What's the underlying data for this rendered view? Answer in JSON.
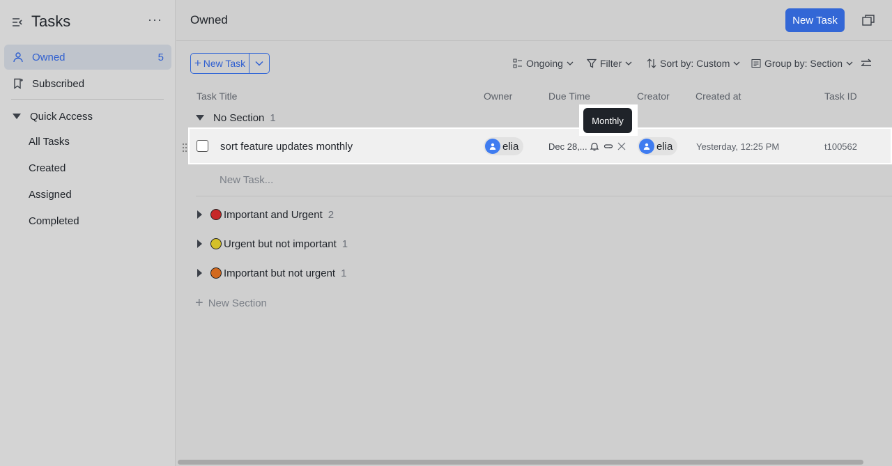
{
  "sidebar": {
    "title": "Tasks",
    "more": "···",
    "nav": [
      {
        "label": "Owned",
        "count": "5"
      },
      {
        "label": "Subscribed"
      }
    ],
    "quick_access": {
      "label": "Quick Access",
      "items": [
        "All Tasks",
        "Created",
        "Assigned",
        "Completed"
      ]
    }
  },
  "header": {
    "title": "Owned",
    "new_task_button": "New Task"
  },
  "toolbar": {
    "new_task_split": "New Task",
    "ongoing": "Ongoing",
    "filter": "Filter",
    "sort": "Sort by: Custom",
    "group": "Group by: Section"
  },
  "columns": [
    "Task Title",
    "Owner",
    "Due Time",
    "Creator",
    "Created at",
    "Task ID"
  ],
  "sections": [
    {
      "name": "No Section",
      "count": "1",
      "expanded": true
    },
    {
      "name": "Important and Urgent",
      "count": "2",
      "color": "#c62828"
    },
    {
      "name": "Urgent but not important",
      "count": "1",
      "color": "#d4c02a"
    },
    {
      "name": "Important but not urgent",
      "count": "1",
      "color": "#d2691e"
    }
  ],
  "task": {
    "title": "sort feature updates monthly",
    "owner": "elia",
    "due": "Dec 28,...",
    "creator": "elia",
    "created_at": "Yesterday, 12:25 PM",
    "id": "t100562"
  },
  "tooltip": "Monthly",
  "new_task_placeholder": "New Task...",
  "new_section": "New Section",
  "colors": {
    "accent": "#3367d6",
    "avatar": "#3f7cf0"
  }
}
